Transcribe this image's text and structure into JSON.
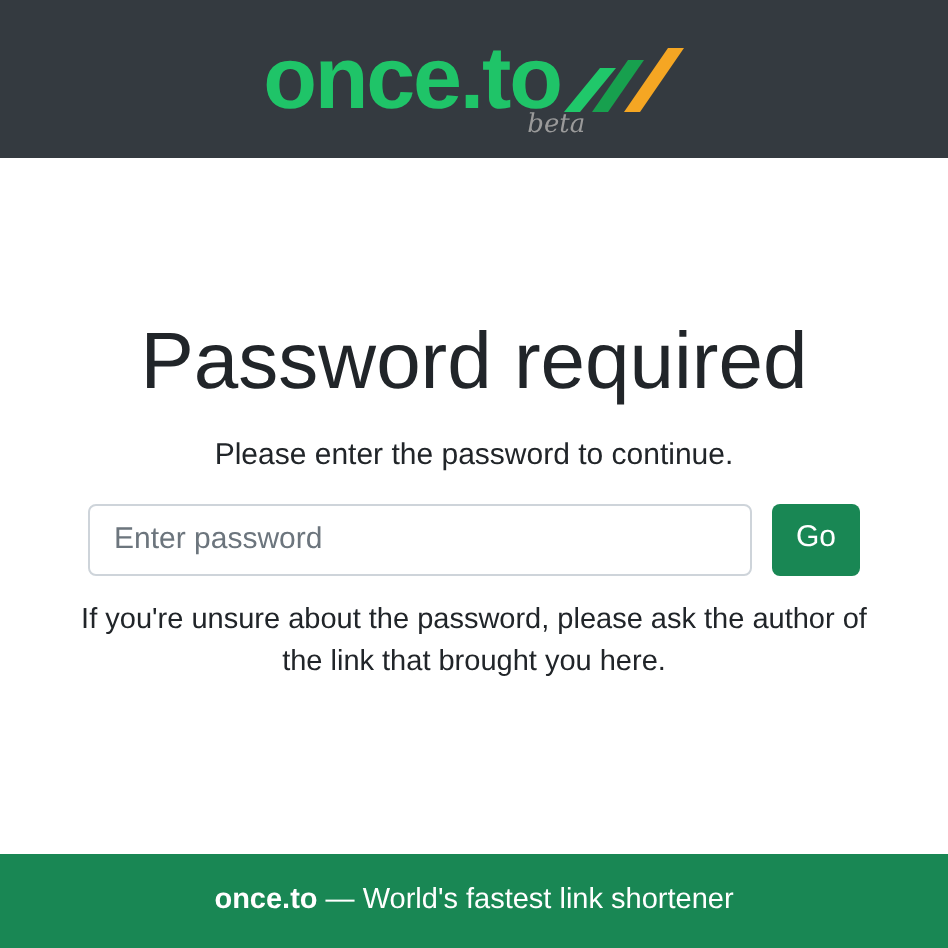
{
  "header": {
    "logo": "once.to",
    "logo_tag": "beta"
  },
  "main": {
    "title": "Password required",
    "subtitle": "Please enter the password to continue.",
    "password_field": {
      "placeholder": "Enter password"
    },
    "submit_button": "Go",
    "help_text": "If you're unsure about the password, please ask the author of the link that brought you here."
  },
  "footer": {
    "text": "**once.to** — World's fastest link shortener"
  }
}
